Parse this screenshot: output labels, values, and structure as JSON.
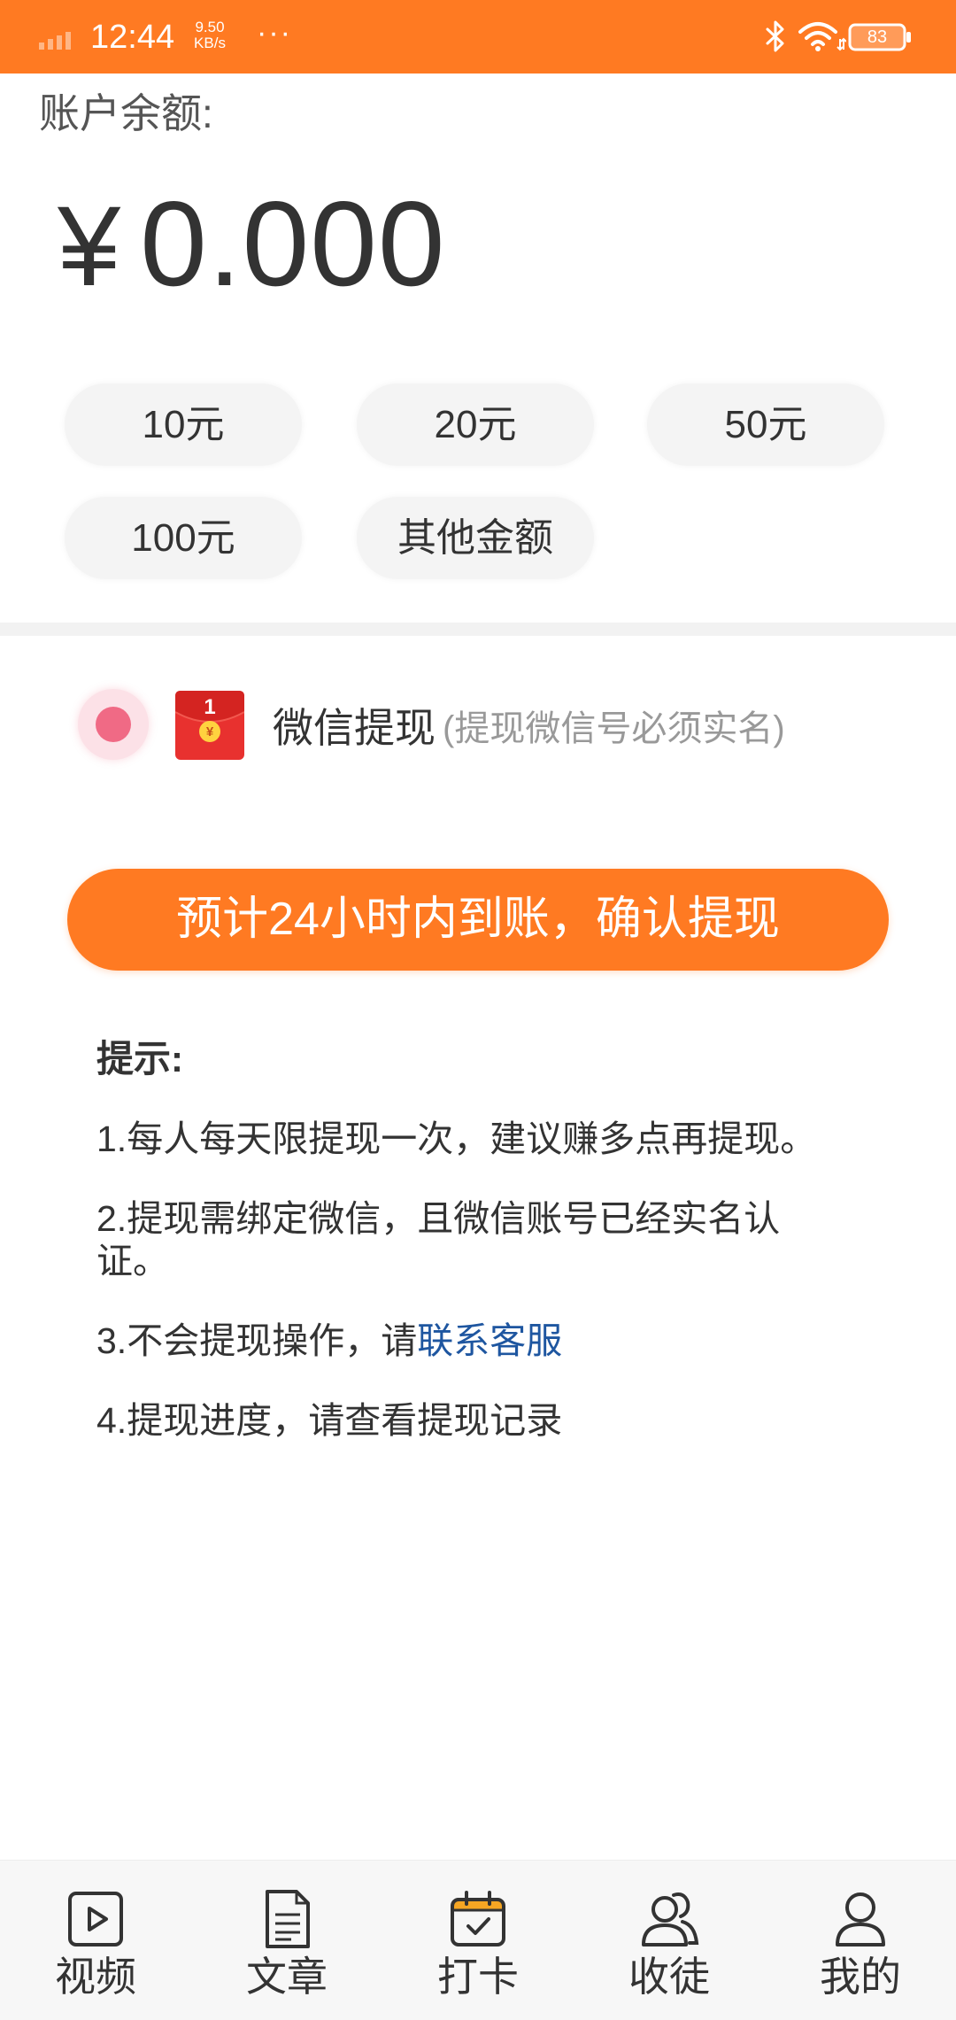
{
  "status_bar": {
    "time": "12:44",
    "net_speed_value": "9.50",
    "net_speed_unit": "KB/s",
    "more": "···",
    "battery": "83",
    "icons": [
      "signal-icon",
      "bluetooth-icon",
      "wifi-icon",
      "battery-icon"
    ]
  },
  "balance": {
    "label": "账户余额:",
    "currency": "¥",
    "amount": "0.000"
  },
  "amount_options": [
    {
      "label": "10元"
    },
    {
      "label": "20元"
    },
    {
      "label": "50元"
    },
    {
      "label": "100元"
    },
    {
      "label": "其他金额"
    }
  ],
  "payment_method": {
    "selected": true,
    "icon": "red-packet-icon",
    "icon_number": "1",
    "icon_symbol": "¥",
    "name": "微信提现",
    "note": "(提现微信号必须实名)"
  },
  "confirm_button": {
    "label": "预计24小时内到账，确认提现"
  },
  "tips": {
    "title": "提示:",
    "items": [
      {
        "text": "1.每人每天限提现一次，建议赚多点再提现。"
      },
      {
        "text": "2.提现需绑定微信，且微信账号已经实名认证。"
      },
      {
        "prefix": "3.不会提现操作，请",
        "link": "联系客服"
      },
      {
        "text": "4.提现进度，请查看提现记录"
      }
    ]
  },
  "tab_bar": {
    "items": [
      {
        "label": "视频",
        "icon": "video-icon"
      },
      {
        "label": "文章",
        "icon": "article-icon"
      },
      {
        "label": "打卡",
        "icon": "calendar-check-icon"
      },
      {
        "label": "收徒",
        "icon": "people-icon"
      },
      {
        "label": "我的",
        "icon": "user-icon"
      }
    ]
  },
  "colors": {
    "accent": "#FF7A22",
    "link": "#1E56A0",
    "radio": "#F06A85",
    "packet": "#E8312F"
  }
}
